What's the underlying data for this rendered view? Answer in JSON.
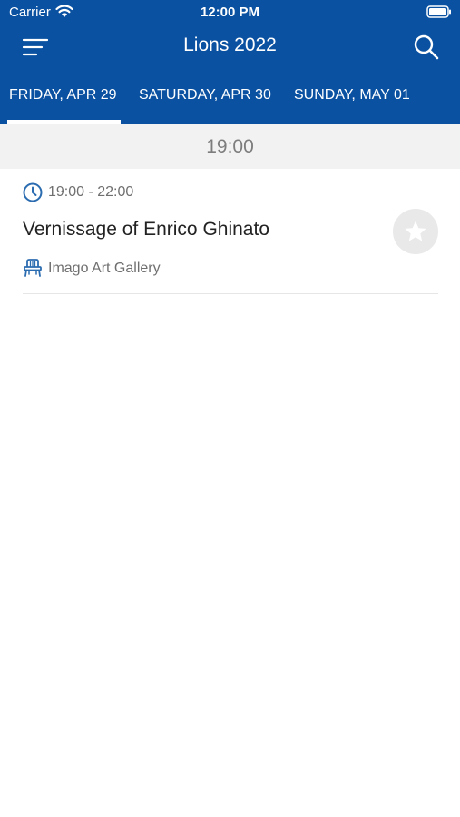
{
  "status_bar": {
    "carrier": "Carrier",
    "time": "12:00 PM"
  },
  "header": {
    "title": "Lions 2022"
  },
  "tabs": [
    {
      "label": "FRIDAY, APR 29",
      "selected": true
    },
    {
      "label": "SATURDAY, APR 30",
      "selected": false
    },
    {
      "label": "SUNDAY, MAY 01",
      "selected": false
    }
  ],
  "schedule": {
    "time_group": "19:00",
    "sessions": [
      {
        "time_range": "19:00 - 22:00",
        "title": "Vernissage of Enrico Ghinato",
        "venue": "Imago Art Gallery",
        "favorited": false
      }
    ]
  },
  "colors": {
    "header_bg": "#0a51a1",
    "icon_blue": "#2b6cb0",
    "fav_bg": "#e9e9e9"
  },
  "icons": [
    "wifi-icon",
    "battery-icon",
    "menu-icon",
    "search-icon",
    "clock-icon",
    "chair-icon",
    "star-icon"
  ]
}
